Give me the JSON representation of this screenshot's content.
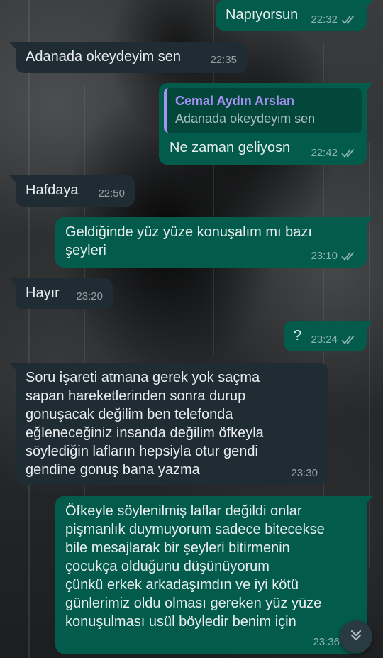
{
  "colors": {
    "incoming_bubble": "#1f2c34",
    "outgoing_bubble": "#035c4b",
    "quote_accent": "#a791f5",
    "text": "#e9edef"
  },
  "messages": [
    {
      "direction": "out",
      "text": "Napıyorsun",
      "time": "22:32",
      "status": "read-double-check"
    },
    {
      "direction": "in",
      "text": "Adanada okeydeyim sen",
      "time": "22:35"
    },
    {
      "direction": "out",
      "reply": {
        "author": "Cemal Aydın Arslan",
        "text": "Adanada okeydeyim sen"
      },
      "text": "Ne zaman geliyosn",
      "time": "22:42",
      "status": "read-double-check"
    },
    {
      "direction": "in",
      "text": "Hafdaya",
      "time": "22:50"
    },
    {
      "direction": "out",
      "text": "Geldiğinde yüz yüze konuşalım mı bazı\nşeyleri",
      "time": "23:10",
      "status": "read-double-check"
    },
    {
      "direction": "in",
      "text": "Hayır",
      "time": "23:20"
    },
    {
      "direction": "out",
      "text": "?",
      "time": "23:24",
      "status": "read-double-check"
    },
    {
      "direction": "in",
      "text": "Soru işareti atmana gerek yok saçma\nsapan hareketlerinden sonra durup\ngonuşacak değilim ben telefonda\neğleneceğiniz insanda değilim öfkeyla\nsöylediğin lafların hepsiyla otur gendi\ngendine gonuş bana yazma",
      "time": "23:30"
    },
    {
      "direction": "out",
      "text": "Öfkeyle söylenilmiş laflar değildi onlar\npişmanlık duymuyorum sadece bitecekse\nbile mesajlarak bir şeyleri bitirmenin\nçocukça olduğunu düşünüyorum\nçünkü erkek arkadaşımdın ve iyi kötü\ngünlerimiz oldu olması gereken yüz yüze\nkonuşulması usül böyledir benim için",
      "time": "23:36",
      "status": "read-double-check"
    }
  ],
  "scroll_button": {
    "icon": "double-chevron-down-icon"
  }
}
